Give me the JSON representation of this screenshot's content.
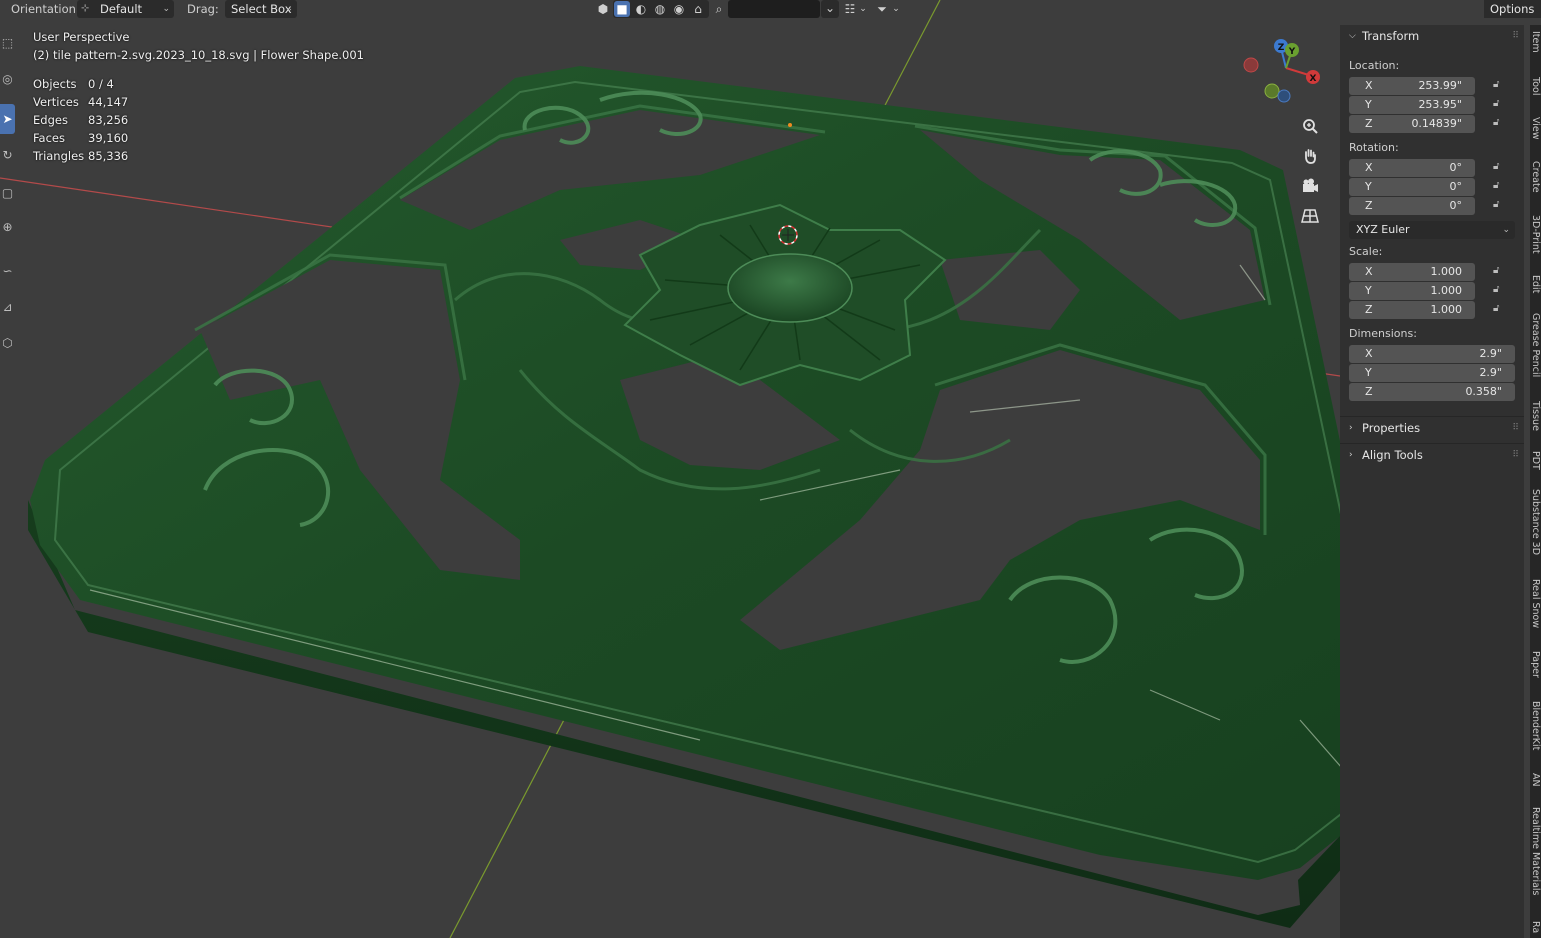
{
  "header": {
    "orientation_label": "Orientation:",
    "orientation_value": "Default",
    "drag_label": "Drag:",
    "drag_value": "Select Box",
    "options_label": "Options"
  },
  "overlay": {
    "perspective": "User Perspective",
    "object_info": "(2) tile pattern-2.svg.2023_10_18.svg | Flower Shape.001",
    "stats": [
      {
        "label": "Objects",
        "value": "0 / 4"
      },
      {
        "label": "Vertices",
        "value": "44,147"
      },
      {
        "label": "Edges",
        "value": "83,256"
      },
      {
        "label": "Faces",
        "value": "39,160"
      },
      {
        "label": "Triangles",
        "value": "85,336"
      }
    ]
  },
  "gizmo": {
    "x": "X",
    "y": "Y",
    "z": "Z"
  },
  "panel": {
    "transform_title": "Transform",
    "location_label": "Location:",
    "location": [
      {
        "axis": "X",
        "value": "253.99\""
      },
      {
        "axis": "Y",
        "value": "253.95\""
      },
      {
        "axis": "Z",
        "value": "0.14839\""
      }
    ],
    "rotation_label": "Rotation:",
    "rotation": [
      {
        "axis": "X",
        "value": "0°"
      },
      {
        "axis": "Y",
        "value": "0°"
      },
      {
        "axis": "Z",
        "value": "0°"
      }
    ],
    "rotation_mode": "XYZ Euler",
    "scale_label": "Scale:",
    "scale": [
      {
        "axis": "X",
        "value": "1.000"
      },
      {
        "axis": "Y",
        "value": "1.000"
      },
      {
        "axis": "Z",
        "value": "1.000"
      }
    ],
    "dimensions_label": "Dimensions:",
    "dimensions": [
      {
        "axis": "X",
        "value": "2.9\""
      },
      {
        "axis": "Y",
        "value": "2.9\""
      },
      {
        "axis": "Z",
        "value": "0.358\""
      }
    ],
    "properties_title": "Properties",
    "align_tools_title": "Align Tools"
  },
  "tabs": [
    "Item",
    "Tool",
    "View",
    "Create",
    "3D-Print",
    "Edit",
    "Grease Pencil",
    "Tissue",
    "PDT",
    "Substance 3D",
    "Real Snow",
    "Paper",
    "BlenderKit",
    "AN",
    "Realtime Materials",
    "Ra"
  ],
  "colors": {
    "viewport_bg": "#3d3d3d",
    "tile_green": "#1d4a26",
    "x_axis": "#b34a4a",
    "y_axis": "#7a9a2e",
    "active_blue": "#4a72b0"
  }
}
